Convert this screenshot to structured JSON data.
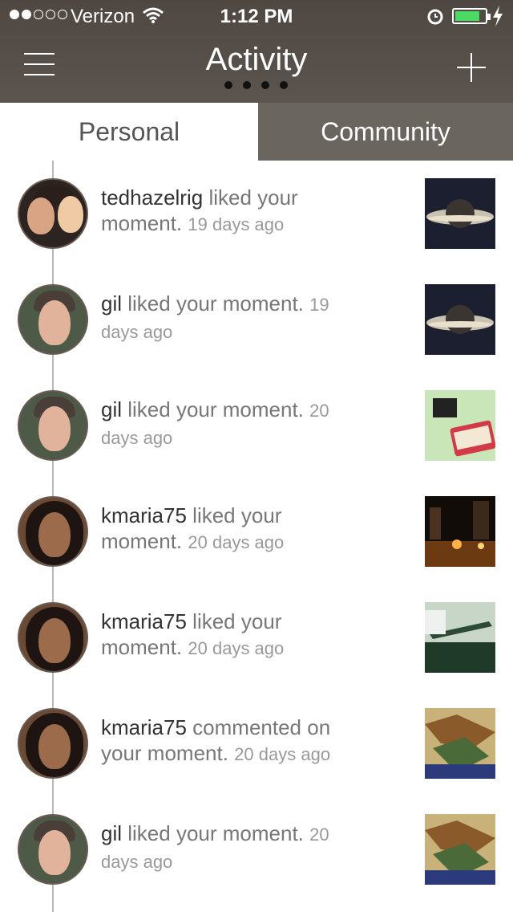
{
  "status_bar": {
    "carrier": "Verizon",
    "time": "1:12 PM"
  },
  "header": {
    "title": "Activity"
  },
  "tabs": {
    "personal": "Personal",
    "community": "Community"
  },
  "colors": {
    "header_bg": "#564f49",
    "tab_active_bg": "#ffffff",
    "tab_inactive_bg": "#6b6560",
    "battery_green": "#4cd964"
  },
  "feed": [
    {
      "user": "tedhazelrig",
      "action": "liked your moment.",
      "time": "19 days ago",
      "thumbnail": "saturn"
    },
    {
      "user": "gil",
      "action": "liked your moment.",
      "time": "19 days ago",
      "thumbnail": "saturn"
    },
    {
      "user": "gil",
      "action": "liked your moment.",
      "time": "20 days ago",
      "thumbnail": "altoids"
    },
    {
      "user": "kmaria75",
      "action": "liked your moment.",
      "time": "20 days ago",
      "thumbnail": "night-city"
    },
    {
      "user": "kmaria75",
      "action": "liked your moment.",
      "time": "20 days ago",
      "thumbnail": "helicopter"
    },
    {
      "user": "kmaria75",
      "action": "commented on your moment.",
      "time": "20 days ago",
      "thumbnail": "graffiti"
    },
    {
      "user": "gil",
      "action": "liked your moment.",
      "time": "20 days ago",
      "thumbnail": "graffiti"
    }
  ],
  "icons": [
    "signal-dots-icon",
    "wifi-icon",
    "alarm-icon",
    "battery-icon",
    "charging-bolt-icon",
    "hamburger-menu-icon",
    "plus-icon"
  ]
}
